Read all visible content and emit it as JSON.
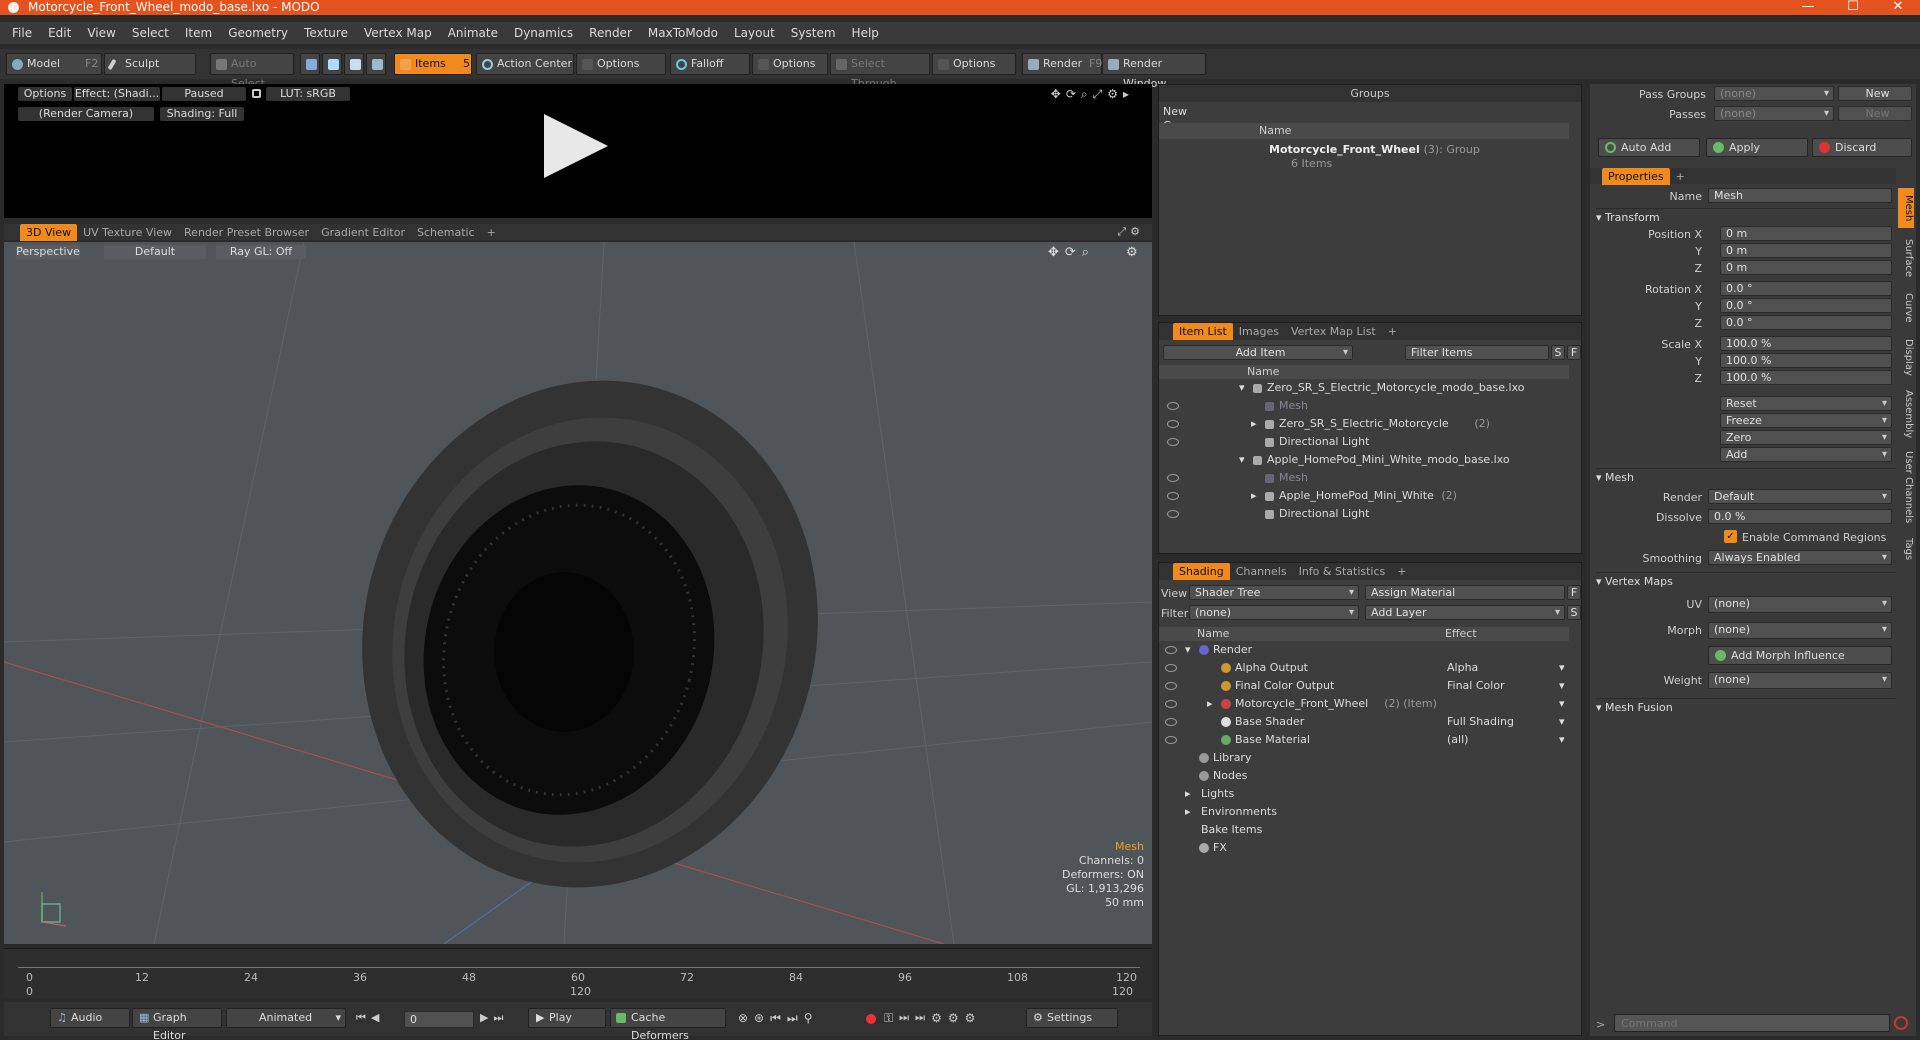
{
  "window": {
    "title": "Motorcycle_Front_Wheel_modo_base.lxo - MODO",
    "minimize": "—",
    "maximize": "☐",
    "close": "✕"
  },
  "menu": [
    "File",
    "Edit",
    "View",
    "Select",
    "Item",
    "Geometry",
    "Texture",
    "Vertex Map",
    "Animate",
    "Dynamics",
    "Render",
    "MaxToModo",
    "Layout",
    "System",
    "Help"
  ],
  "toolbar": {
    "model": "Model",
    "model_key": "F2",
    "sculpt": "Sculpt",
    "auto_select": "Auto Select",
    "items": "Items",
    "items_key": "5",
    "action_center": "Action Center",
    "options1": "Options",
    "falloff": "Falloff",
    "options2": "Options",
    "select_through": "Select Through",
    "options3": "Options",
    "render": "Render",
    "render_key": "F9",
    "render_window": "Render Window"
  },
  "preview": {
    "options": "Options",
    "effect": "Effect: (Shadi...",
    "paused": "Paused",
    "lut": "LUT: sRGB",
    "camera": "(Render Camera)",
    "shading": "Shading: Full"
  },
  "viewport_tabs": [
    "3D View",
    "UV Texture View",
    "Render Preset Browser",
    "Gradient Editor",
    "Schematic",
    "+"
  ],
  "viewport": {
    "perspective": "Perspective",
    "default": "Default",
    "raygl": "Ray GL: Off",
    "stats": {
      "title": "Mesh",
      "channels": "Channels: 0",
      "deformers": "Deformers: ON",
      "gl": "GL: 1,913,296",
      "focal": "50 mm"
    }
  },
  "timeline": {
    "ticks": [
      "0",
      "12",
      "24",
      "36",
      "48",
      "60",
      "72",
      "84",
      "96",
      "108",
      "120"
    ],
    "sub": [
      "0",
      "120",
      "120"
    ]
  },
  "bottombar": {
    "audio": "Audio",
    "graph_editor": "Graph Editor",
    "animated": "Animated",
    "frame": "0",
    "play": "Play",
    "cache": "Cache Deformers",
    "settings": "Settings"
  },
  "groups": {
    "title": "Groups",
    "new_group": "New Group",
    "col_name": "Name",
    "item_name": "Motorcycle_Front_Wheel",
    "item_count": "(3)",
    "item_type": ": Group",
    "item_sub": "6 Items"
  },
  "itemlist": {
    "tabs": [
      "Item List",
      "Images",
      "Vertex Map List",
      "+"
    ],
    "add_item": "Add Item",
    "filter": "Filter Items",
    "s": "S",
    "f": "F",
    "col_name": "Name",
    "rows": [
      {
        "label": "Zero_SR_S_Electric_Motorcycle_modo_base.lxo",
        "extra": ""
      },
      {
        "label": "Mesh",
        "extra": ""
      },
      {
        "label": "Zero_SR_S_Electric_Motorcycle",
        "extra": "(2)"
      },
      {
        "label": "Directional Light",
        "extra": ""
      },
      {
        "label": "Apple_HomePod_Mini_White_modo_base.lxo",
        "extra": ""
      },
      {
        "label": "Mesh",
        "extra": ""
      },
      {
        "label": "Apple_HomePod_Mini_White",
        "extra": "(2)"
      },
      {
        "label": "Directional Light",
        "extra": ""
      }
    ]
  },
  "shading": {
    "tabs": [
      "Shading",
      "Channels",
      "Info & Statistics",
      "+"
    ],
    "view_label": "View",
    "view_value": "Shader Tree",
    "assign": "Assign Material",
    "f": "F",
    "filter_label": "Filter",
    "filter_value": "(none)",
    "add_layer": "Add Layer",
    "s": "S",
    "col_name": "Name",
    "col_effect": "Effect",
    "rows": [
      {
        "label": "Render",
        "extra": "",
        "effect": ""
      },
      {
        "label": "Alpha Output",
        "extra": "",
        "effect": "Alpha"
      },
      {
        "label": "Final Color Output",
        "extra": "",
        "effect": "Final Color"
      },
      {
        "label": "Motorcycle_Front_Wheel",
        "extra": "(2) (Item)",
        "effect": ""
      },
      {
        "label": "Base Shader",
        "extra": "",
        "effect": "Full Shading"
      },
      {
        "label": "Base Material",
        "extra": "",
        "effect": "(all)"
      },
      {
        "label": "Library",
        "extra": "",
        "effect": ""
      },
      {
        "label": "Nodes",
        "extra": "",
        "effect": ""
      },
      {
        "label": "Lights",
        "extra": "",
        "effect": ""
      },
      {
        "label": "Environments",
        "extra": "",
        "effect": ""
      },
      {
        "label": "Bake Items",
        "extra": "",
        "effect": ""
      },
      {
        "label": "FX",
        "extra": "",
        "effect": ""
      }
    ]
  },
  "passes": {
    "pass_groups": "Pass Groups",
    "passes": "Passes",
    "none": "(none)",
    "new": "New",
    "auto_add": "Auto Add",
    "apply": "Apply",
    "discard": "Discard"
  },
  "properties": {
    "tab": "Properties",
    "plus": "+",
    "name_label": "Name",
    "name_value": "Mesh",
    "transform": "Transform",
    "position_x_label": "Position X",
    "y": "Y",
    "z": "Z",
    "pos": [
      "0 m",
      "0 m",
      "0 m"
    ],
    "rotation_x_label": "Rotation X",
    "rot": [
      "0.0 °",
      "0.0 °",
      "0.0 °"
    ],
    "scale_x_label": "Scale X",
    "scl": [
      "100.0 %",
      "100.0 %",
      "100.0 %"
    ],
    "reset": "Reset",
    "freeze": "Freeze",
    "zero": "Zero",
    "add": "Add",
    "mesh": "Mesh",
    "render_label": "Render",
    "render_value": "Default",
    "dissolve_label": "Dissolve",
    "dissolve_value": "0.0 %",
    "enable_cmd": "Enable Command Regions",
    "smoothing_label": "Smoothing",
    "smoothing_value": "Always Enabled",
    "vertex_maps": "Vertex Maps",
    "uv_label": "UV",
    "uv_value": "(none)",
    "morph_label": "Morph",
    "morph_value": "(none)",
    "add_morph": "Add Morph Influence",
    "weight_label": "Weight",
    "weight_value": "(none)",
    "mesh_fusion": "Mesh Fusion"
  },
  "side_tabs": [
    "Mesh",
    "Surface",
    "Curve",
    "Display",
    "Assembly",
    "User Channels",
    "Tags"
  ],
  "command": {
    "placeholder": "Command"
  },
  "colors": {
    "accent": "#f08a1d",
    "titlebar": "#e2531f",
    "viewport": "#4f5559"
  }
}
